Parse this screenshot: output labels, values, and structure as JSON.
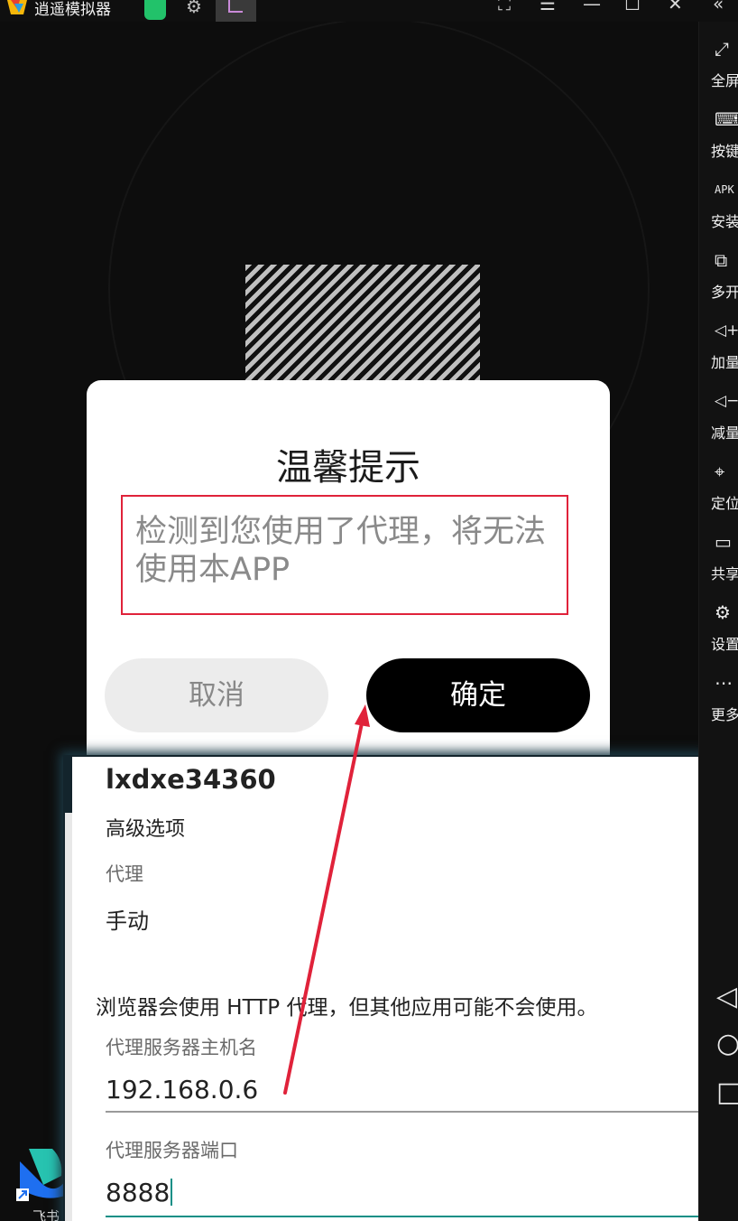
{
  "window": {
    "title": "逍遥模拟器",
    "controls": [
      "⛶",
      "☰",
      "—",
      "☐",
      "✕",
      "«"
    ]
  },
  "sidebar": {
    "items": [
      {
        "label": "全屏",
        "icon": "fullscreen-icon",
        "glyph": "⤢"
      },
      {
        "label": "按键",
        "icon": "keyboard-icon",
        "glyph": "⌨"
      },
      {
        "label": "安装",
        "icon": "apk-icon",
        "glyph": "APK"
      },
      {
        "label": "多开",
        "icon": "multi-instance-icon",
        "glyph": "⧉"
      },
      {
        "label": "加量",
        "icon": "volume-up-icon",
        "glyph": "◁+"
      },
      {
        "label": "减量",
        "icon": "volume-down-icon",
        "glyph": "◁−"
      },
      {
        "label": "定位",
        "icon": "location-icon",
        "glyph": "⌖"
      },
      {
        "label": "共享",
        "icon": "folder-icon",
        "glyph": "▭"
      },
      {
        "label": "设置",
        "icon": "gear-icon",
        "glyph": "⚙"
      },
      {
        "label": "更多",
        "icon": "more-icon",
        "glyph": "⋯"
      }
    ],
    "nav": [
      "◁",
      "○",
      "□"
    ]
  },
  "dialog": {
    "title": "温馨提示",
    "message": "检测到您使用了代理，将无法使用本APP",
    "cancel_label": "取消",
    "ok_label": "确定"
  },
  "settings_panel": {
    "ssid": "lxdxe34360",
    "advanced_label": "高级选项",
    "proxy_label": "代理",
    "proxy_value": "手动",
    "note": "浏览器会使用 HTTP 代理，但其他应用可能不会使用。",
    "host_label": "代理服务器主机名",
    "host_value": "192.168.0.6",
    "port_label": "代理服务器端口",
    "port_value": "8888"
  },
  "desktop": {
    "icon_label": "飞书"
  },
  "colors": {
    "highlight_box": "#e0223a",
    "annotation_arrow": "#e0223a",
    "ok_button": "#000000",
    "focus_underline": "#0f8f86"
  }
}
